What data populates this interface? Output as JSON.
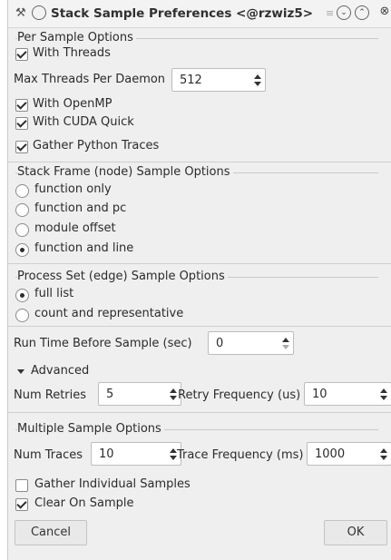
{
  "window": {
    "title": "Stack Sample Preferences <@rzwiz5>",
    "icon": "tools-icon"
  },
  "per_sample": {
    "title": "Per Sample Options",
    "with_threads": {
      "label": "With Threads",
      "checked": true
    },
    "max_threads": {
      "label": "Max Threads Per Daemon",
      "value": "512"
    },
    "with_openmp": {
      "label": "With OpenMP",
      "checked": true
    },
    "with_cuda": {
      "label": "With CUDA Quick",
      "checked": true
    },
    "gather_python": {
      "label": "Gather Python Traces",
      "checked": true
    }
  },
  "stack_frame": {
    "title": "Stack Frame (node) Sample Options",
    "options": [
      {
        "label": "function only",
        "selected": false
      },
      {
        "label": "function and pc",
        "selected": false
      },
      {
        "label": "module offset",
        "selected": false
      },
      {
        "label": "function and line",
        "selected": true
      }
    ]
  },
  "process_set": {
    "title": "Process Set (edge) Sample Options",
    "options": [
      {
        "label": "full list",
        "selected": true
      },
      {
        "label": "count and representative",
        "selected": false
      }
    ]
  },
  "run_time": {
    "label": "Run Time Before Sample (sec)",
    "value": "0"
  },
  "advanced": {
    "label": "Advanced",
    "expanded": true,
    "num_retries": {
      "label": "Num Retries",
      "value": "5"
    },
    "retry_frequency": {
      "label": "Retry Frequency (us)",
      "value": "10"
    }
  },
  "multiple": {
    "title": "Multiple Sample Options",
    "num_traces": {
      "label": "Num Traces",
      "value": "10"
    },
    "trace_frequency": {
      "label": "Trace Frequency (ms)",
      "value": "1000"
    },
    "gather_individual": {
      "label": "Gather Individual Samples",
      "checked": false
    },
    "clear_on_sample": {
      "label": "Clear On Sample",
      "checked": true
    }
  },
  "buttons": {
    "cancel": "Cancel",
    "ok": "OK"
  }
}
